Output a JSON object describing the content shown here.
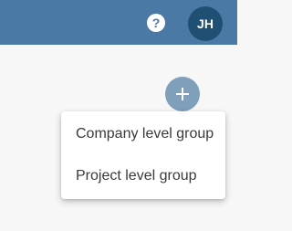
{
  "header": {
    "help_symbol": "?",
    "help_icon": "help-circle-icon",
    "avatar_initials": "JH"
  },
  "actions": {
    "add_icon": "plus-icon"
  },
  "menu": {
    "items": [
      {
        "label": "Company level group"
      },
      {
        "label": "Project level group"
      }
    ]
  },
  "colors": {
    "header_bg": "#4a79a6",
    "avatar_bg": "#1f4f72",
    "add_button_bg": "#7f9fbb",
    "page_bg": "#f7f7f7"
  }
}
